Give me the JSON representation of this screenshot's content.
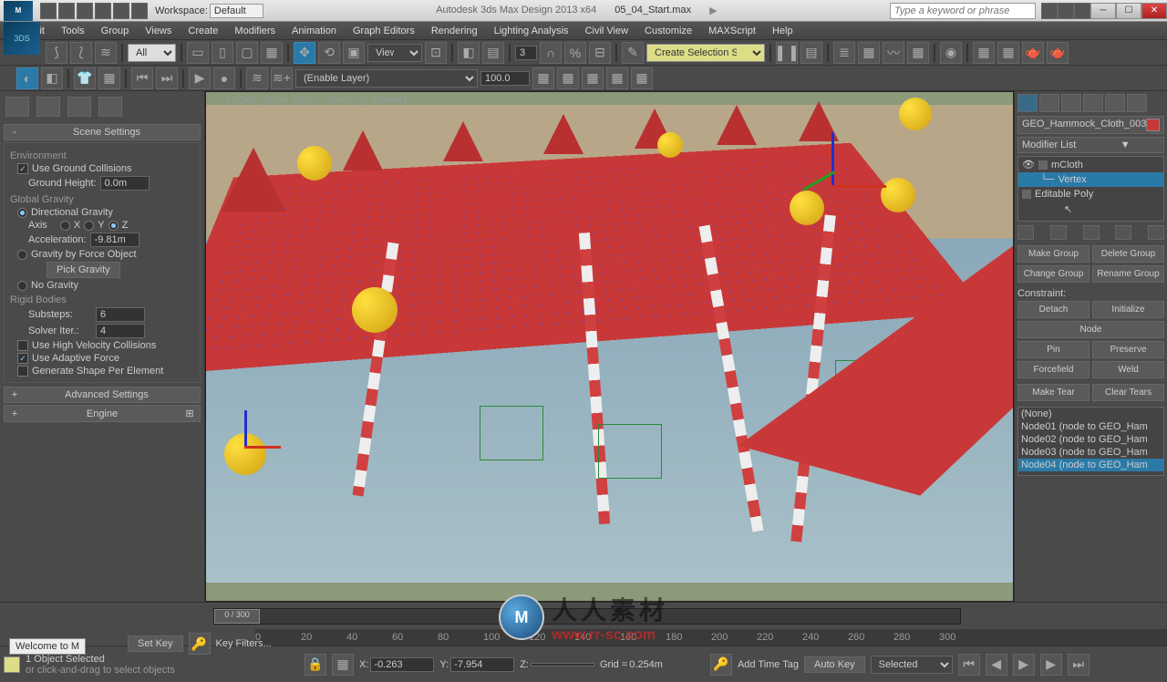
{
  "title": {
    "app": "Autodesk 3ds Max Design 2013 x64",
    "file": "05_04_Start.max",
    "search_placeholder": "Type a keyword or phrase",
    "workspace_label": "Workspace:",
    "workspace_value": "Default"
  },
  "menu": [
    "Edit",
    "Tools",
    "Group",
    "Views",
    "Create",
    "Modifiers",
    "Animation",
    "Graph Editors",
    "Rendering",
    "Lighting Analysis",
    "Civil View",
    "Customize",
    "MAXScript",
    "Help"
  ],
  "toolbar1": {
    "filter": "All",
    "refcoord": "View",
    "spinner": "3",
    "selset": "Create Selection Se"
  },
  "toolbar2": {
    "layer": "(Enable Layer)",
    "value": "100.0"
  },
  "viewport": {
    "label": "[ + ] [ CAM_Single_Target_CloseUp ] [ Shaded ]"
  },
  "scene_settings": {
    "title": "Scene Settings",
    "environment": "Environment",
    "use_ground": "Use Ground Collisions",
    "ground_height_label": "Ground Height:",
    "ground_height": "0.0m",
    "global_gravity": "Global Gravity",
    "directional": "Directional Gravity",
    "axis": "Axis",
    "x": "X",
    "y": "Y",
    "z": "Z",
    "accel_label": "Acceleration:",
    "accel": "-9.81m",
    "force_object": "Gravity by Force Object",
    "pick_gravity": "Pick Gravity",
    "no_gravity": "No Gravity",
    "rigid": "Rigid Bodies",
    "substeps_label": "Substeps:",
    "substeps": "6",
    "solver_label": "Solver Iter.:",
    "solver": "4",
    "high_vel": "Use High Velocity Collisions",
    "adaptive": "Use Adaptive Force",
    "gen_shape": "Generate Shape Per Element",
    "advanced": "Advanced Settings",
    "engine": "Engine"
  },
  "command_panel": {
    "name": "GEO_Hammock_Cloth_003",
    "modifier_list": "Modifier List",
    "stack": {
      "r0": "mCloth",
      "r1": "Vertex",
      "r2": "Editable Poly"
    },
    "groups": {
      "make": "Make Group",
      "delete": "Delete Group",
      "change": "Change Group",
      "rename": "Rename Group"
    },
    "constraint": "Constraint:",
    "buttons": {
      "detach": "Detach",
      "initialize": "Initialize",
      "node": "Node",
      "pin": "Pin",
      "preserve": "Preserve",
      "forcefield": "Forcefield",
      "weld": "Weld",
      "maketear": "Make Tear",
      "cleartears": "Clear Tears"
    },
    "nodes": [
      "(None)",
      "Node01 (node to GEO_Ham",
      "Node02 (node to GEO_Ham",
      "Node03 (node to GEO_Ham",
      "Node04 (node to GEO_Ham"
    ]
  },
  "timeline": {
    "pos": "0 / 300",
    "ticks": [
      "0",
      "20",
      "40",
      "60",
      "80",
      "100",
      "120",
      "140",
      "160",
      "180",
      "200",
      "220",
      "240",
      "260",
      "280",
      "300"
    ]
  },
  "status": {
    "selected": "1 Object Selected",
    "hint": "or click-and-drag to select objects",
    "x": "-0.263",
    "y": "-7.954",
    "z": "",
    "grid": "0.254m",
    "autokey": "Auto Key",
    "setkey": "Set Key",
    "selected_mode": "Selected",
    "keyfilters": "Key Filters...",
    "addtimetag": "Add Time Tag",
    "welcome": "Welcome to M"
  },
  "watermark": {
    "text1": "人人素材",
    "text2": "www.rr-sc.com"
  }
}
